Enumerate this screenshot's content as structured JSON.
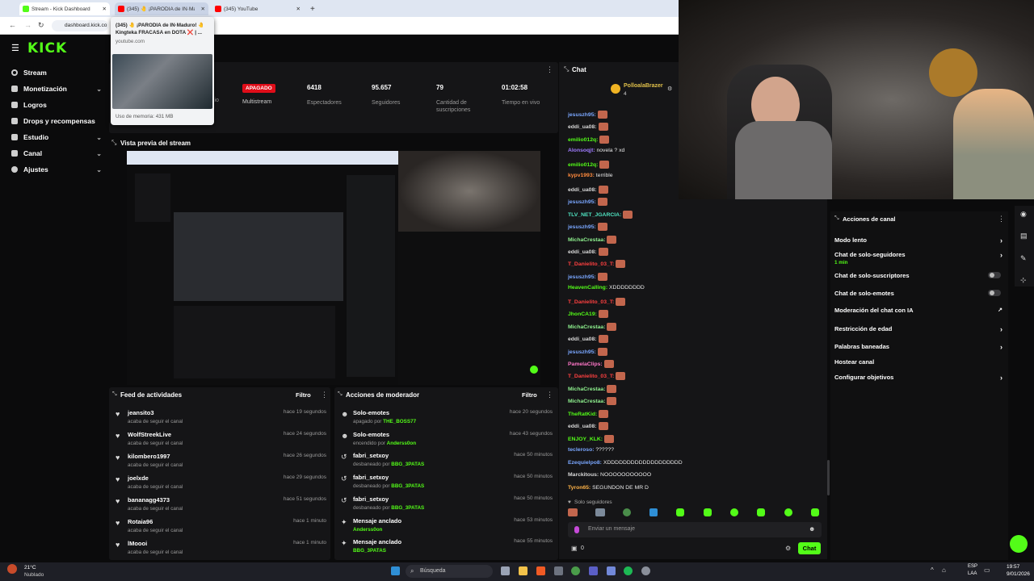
{
  "browser": {
    "tabs": [
      {
        "title": "Stream - Kick Dashboard",
        "color": "#53fc18"
      },
      {
        "title": "(345) 🤚 ¡PARODIA de IN·Mad",
        "color": "#ff0000"
      },
      {
        "title": "(345) YouTube",
        "color": "#ff0000"
      }
    ],
    "url": "dashboard.kick.co",
    "popup": {
      "title": "(345) 🤚 ¡PARODIA de IN·Maduro! 🤚 Kingteka FRACASA en DOTA ❌ | ...",
      "domain": "youtube.com",
      "memory": "Uso de memoria: 431 MB"
    }
  },
  "brand": {
    "logo": "KICK",
    "accent": "#53fc18"
  },
  "sidebar": {
    "items": [
      {
        "label": "Stream",
        "icon": "broadcast-icon",
        "chev": ""
      },
      {
        "label": "Monetización",
        "icon": "money-icon",
        "chev": "⌄"
      },
      {
        "label": "Logros",
        "icon": "trophy-icon",
        "chev": ""
      },
      {
        "label": "Drops y recompensas",
        "icon": "gift-icon",
        "chev": ""
      },
      {
        "label": "Estudio",
        "icon": "studio-icon",
        "chev": "⌄"
      },
      {
        "label": "Canal",
        "icon": "channel-icon",
        "chev": "⌄"
      },
      {
        "label": "Ajustes",
        "icon": "gear-icon",
        "chev": "⌄"
      }
    ]
  },
  "stats": {
    "hidden_label": "cio",
    "multistream_badge": "APAGADO",
    "multistream_label": "Multistream",
    "viewers": {
      "value": "6418",
      "label": "Espectadores"
    },
    "followers": {
      "value": "95.657",
      "label": "Seguidores"
    },
    "subs": {
      "value": "79",
      "label": "Cantidad de suscripciones"
    },
    "uptime": {
      "value": "01:02:58",
      "label": "Tiempo en vivo"
    }
  },
  "preview": {
    "title": "Vista previa del stream"
  },
  "activity": {
    "title": "Feed de actividades",
    "filter": "Filtro",
    "items": [
      {
        "name": "jeansito3",
        "sub": "acaba de seguir el canal",
        "time": "hace 19 segundos"
      },
      {
        "name": "WolfStreekLive",
        "sub": "acaba de seguir el canal",
        "time": "hace 24 segundos"
      },
      {
        "name": "kilombero1997",
        "sub": "acaba de seguir el canal",
        "time": "hace 26 segundos"
      },
      {
        "name": "joelxde",
        "sub": "acaba de seguir el canal",
        "time": "hace 29 segundos"
      },
      {
        "name": "bananagg4373",
        "sub": "acaba de seguir el canal",
        "time": "hace 51 segundos"
      },
      {
        "name": "Rotaia96",
        "sub": "acaba de seguir el canal",
        "time": "hace 1 minuto"
      },
      {
        "name": "lMoooi",
        "sub": "acaba de seguir el canal",
        "time": "hace 1 minuto"
      }
    ]
  },
  "modactions": {
    "title": "Acciones de moderador",
    "filter": "Filtro",
    "items": [
      {
        "name": "Solo-emotes",
        "pre": "apagado por",
        "by": "THE_BOSS77",
        "time": "hace 20 segundos"
      },
      {
        "name": "Solo-emotes",
        "pre": "encendido por",
        "by": "Anderss0on",
        "time": "hace 43 segundos"
      },
      {
        "name": "fabri_setxoy",
        "pre": "desbaneado por",
        "by": "BBG_3PATAS",
        "time": "hace 50 minutos"
      },
      {
        "name": "fabri_setxoy",
        "pre": "desbaneado por",
        "by": "BBG_3PATAS",
        "time": "hace 50 minutos"
      },
      {
        "name": "fabri_setxoy",
        "pre": "desbaneado por",
        "by": "BBG_3PATAS",
        "time": "hace 50 minutos"
      },
      {
        "name": "Mensaje anclado",
        "pre": "",
        "by": "Anderss0on",
        "time": "hace 53 minutos"
      },
      {
        "name": "Mensaje anclado",
        "pre": "",
        "by": "BBG_3PATAS",
        "time": "hace 55 minutos"
      }
    ]
  },
  "chat": {
    "title": "Chat",
    "pinned_user": "PolloalaBrazer",
    "pinned_count": "4",
    "messages": [
      {
        "user": "jesuszh95:",
        "color": "#7aa7ff",
        "text": "",
        "emote": true
      },
      {
        "user": "eddi_ua08:",
        "color": "#d9d9d9",
        "text": "",
        "emote": true
      },
      {
        "user": "emilio012q:",
        "color": "#53fc18",
        "text": "",
        "emote": true
      },
      {
        "user": "Alonsoqjt:",
        "color": "#a07cff",
        "text": "novela ? xd",
        "emote": false
      },
      {
        "user": "emilio012q:",
        "color": "#53fc18",
        "text": "",
        "emote": true
      },
      {
        "user": "kypv1993:",
        "color": "#ff8a3d",
        "text": "terrible",
        "emote": false
      },
      {
        "user": "eddi_ua08:",
        "color": "#d9d9d9",
        "text": "",
        "emote": true
      },
      {
        "user": "jesuszh95:",
        "color": "#7aa7ff",
        "text": "",
        "emote": true
      },
      {
        "user": "TLV_NET_JGARCIA:",
        "color": "#4fe3c1",
        "text": "",
        "emote": true
      },
      {
        "user": "jesuszh95:",
        "color": "#7aa7ff",
        "text": "",
        "emote": true
      },
      {
        "user": "MichaCrestaa:",
        "color": "#8ef08e",
        "text": "",
        "emote": true
      },
      {
        "user": "eddi_ua08:",
        "color": "#d9d9d9",
        "text": "",
        "emote": true
      },
      {
        "user": "T_Danielito_03_T:",
        "color": "#ff4040",
        "text": "",
        "emote": true
      },
      {
        "user": "jesuszh95:",
        "color": "#7aa7ff",
        "text": "",
        "emote": true
      },
      {
        "user": "HeavenCalling:",
        "color": "#53fc18",
        "text": "XDDDDDDDD",
        "emote": false
      },
      {
        "user": "T_Danielito_03_T:",
        "color": "#ff4040",
        "text": "",
        "emote": true
      },
      {
        "user": "JhonCA19:",
        "color": "#53fc18",
        "text": "",
        "emote": true
      },
      {
        "user": "MichaCrestaa:",
        "color": "#8ef08e",
        "text": "",
        "emote": true
      },
      {
        "user": "eddi_ua08:",
        "color": "#d9d9d9",
        "text": "",
        "emote": true
      },
      {
        "user": "jesuszh95:",
        "color": "#7aa7ff",
        "text": "",
        "emote": true
      },
      {
        "user": "PamelaClips:",
        "color": "#ff77c8",
        "text": "",
        "emote": true
      },
      {
        "user": "T_Danielito_03_T:",
        "color": "#ff4040",
        "text": "",
        "emote": true
      },
      {
        "user": "MichaCrestaa:",
        "color": "#8ef08e",
        "text": "",
        "emote": true
      },
      {
        "user": "MichaCrestaa:",
        "color": "#8ef08e",
        "text": "",
        "emote": true
      },
      {
        "user": "TheRatKid:",
        "color": "#53fc18",
        "text": "",
        "emote": true
      },
      {
        "user": "eddi_ua08:",
        "color": "#d9d9d9",
        "text": "",
        "emote": true
      },
      {
        "user": "ENJOY_KLK:",
        "color": "#53fc18",
        "text": "",
        "emote": true
      },
      {
        "user": "tecleroso:",
        "color": "#7aa7ff",
        "text": "??????",
        "emote": false
      },
      {
        "user": "Ezequielpo8:",
        "color": "#7aa7ff",
        "text": "XDDDDDDDDDDDDDDDDDDD",
        "emote": false
      },
      {
        "user": "Marckitous:",
        "color": "#d9d9d9",
        "text": "NOOOOOOOOOOO",
        "emote": false
      },
      {
        "user": "Tyron65:",
        "color": "#ffb347",
        "text": "SEGUNDON DE MR D",
        "emote": false
      }
    ],
    "followers_only": "Solo seguidores",
    "input_placeholder": "Enviar un mensaje",
    "viewer_count": "0",
    "send_label": "Chat"
  },
  "channel_actions": {
    "title": "Acciones de canal",
    "items": [
      {
        "label": "Modo lento",
        "control": "chevron",
        "sub": ""
      },
      {
        "label": "Chat de solo-seguidores",
        "control": "chevron",
        "sub": "1 min"
      },
      {
        "label": "Chat de solo-suscriptores",
        "control": "toggle",
        "sub": ""
      },
      {
        "label": "Chat de solo-emotes",
        "control": "toggle",
        "sub": ""
      },
      {
        "label": "Moderación del chat con IA",
        "control": "external",
        "sub": ""
      },
      {
        "label": "Restricción de edad",
        "control": "chevron",
        "sub": ""
      },
      {
        "label": "Palabras baneadas",
        "control": "chevron",
        "sub": ""
      },
      {
        "label": "Hostear canal",
        "control": "none",
        "sub": ""
      },
      {
        "label": "Configurar objetivos",
        "control": "chevron",
        "sub": ""
      }
    ]
  },
  "taskbar": {
    "weather_temp": "21°C",
    "weather_text": "Nublado",
    "search": "Búsqueda",
    "lang": "ESP",
    "lang2": "LAA",
    "time": "19:57",
    "date": "9/01/2026"
  }
}
